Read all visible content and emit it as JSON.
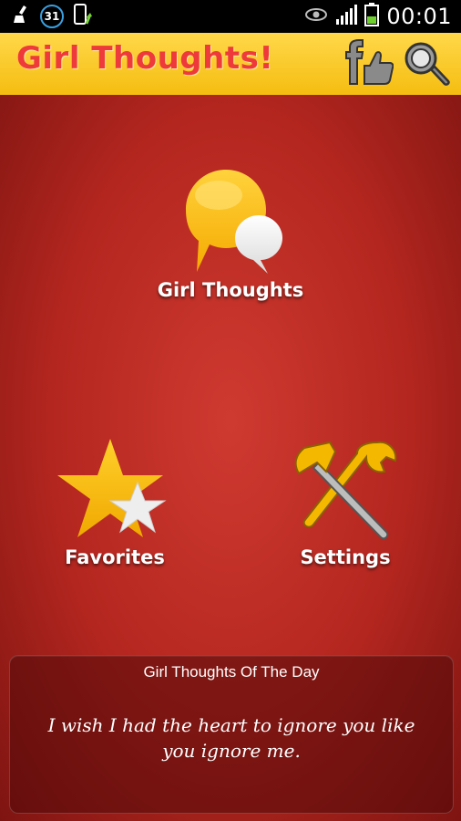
{
  "status_bar": {
    "calendar_day": "31",
    "clock": "00:01",
    "icons": [
      "cleaner-icon",
      "calendar-icon",
      "phone-update-icon",
      "eye-icon",
      "signal-icon",
      "battery-icon"
    ]
  },
  "header": {
    "title": "Girl Thoughts!",
    "facebook_icon": "facebook-like-icon",
    "search_icon": "search-icon",
    "colors": {
      "bar": "#f7c21e",
      "title": "#ee3a3a"
    }
  },
  "menu": {
    "thoughts_label": "Girl Thoughts",
    "favorites_label": "Favorites",
    "settings_label": "Settings"
  },
  "quote_of_day": {
    "title": "Girl Thoughts Of The Day",
    "text": "I wish I had the heart to ignore you like you ignore me."
  },
  "colors": {
    "background": "#b82a22",
    "accent_yellow": "#f9c412"
  }
}
